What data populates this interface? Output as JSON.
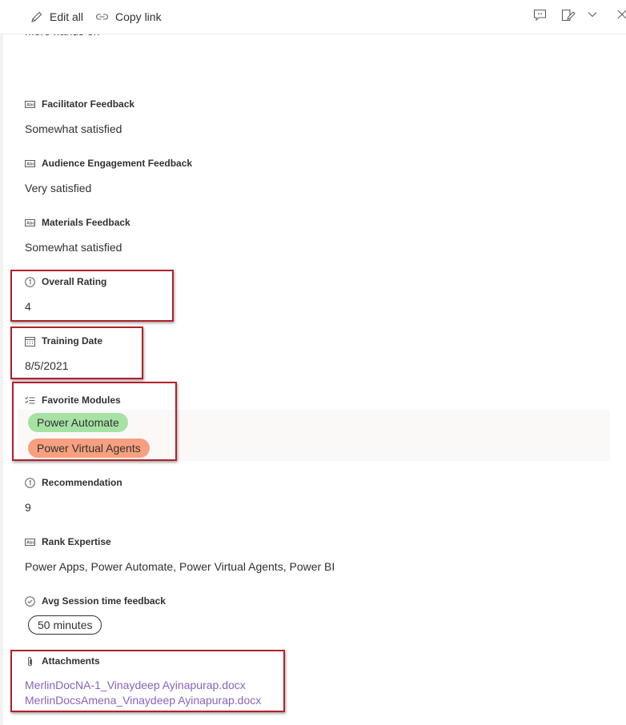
{
  "toolbar": {
    "edit_all_label": "Edit all",
    "copy_link_label": "Copy link",
    "icons": [
      "pencil-icon",
      "link-icon",
      "comment-icon",
      "form-edit-icon",
      "chevron-down-icon",
      "close-icon"
    ]
  },
  "truncated_text": "more hands on",
  "fields": {
    "facilitator": {
      "label": "Facilitator Feedback",
      "value": "Somewhat satisfied",
      "icon": "text-field-icon"
    },
    "audience": {
      "label": "Audience Engagement Feedback",
      "value": "Very satisfied",
      "icon": "text-field-icon"
    },
    "materials": {
      "label": "Materials Feedback",
      "value": "Somewhat satisfied",
      "icon": "text-field-icon"
    },
    "overall": {
      "label": "Overall Rating",
      "value": "4",
      "icon": "number-icon"
    },
    "training_date": {
      "label": "Training Date",
      "value": "8/5/2021",
      "icon": "calendar-icon"
    },
    "favorite_modules": {
      "label": "Favorite Modules",
      "icon": "multi-choice-icon",
      "choices": [
        {
          "text": "Power Automate",
          "color": "#a6e2a4"
        },
        {
          "text": "Power Virtual Agents",
          "color": "#f6a07f"
        }
      ]
    },
    "recommendation": {
      "label": "Recommendation",
      "value": "9",
      "icon": "number-icon"
    },
    "rank_expertise": {
      "label": "Rank Expertise",
      "value": "Power Apps, Power Automate, Power Virtual Agents, Power BI",
      "icon": "text-field-icon"
    },
    "avg_session": {
      "label": "Avg Session time feedback",
      "value": "50 minutes",
      "icon": "choice-check-icon"
    },
    "attachments": {
      "label": "Attachments",
      "icon": "paperclip-icon",
      "files": [
        "MerlinDocNA-1_Vinaydeep Ayinapurap.docx",
        "MerlinDocsAmena_Vinaydeep Ayinapurap.docx"
      ]
    }
  },
  "colors": {
    "highlight_border": "#b2202a",
    "link": "#8764b8",
    "text": "#323130"
  }
}
